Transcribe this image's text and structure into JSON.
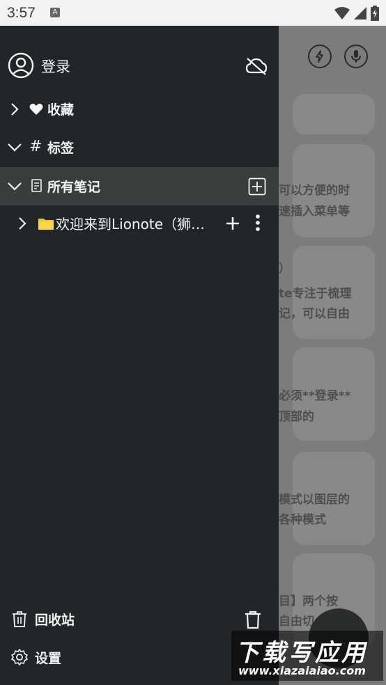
{
  "status_bar": {
    "time": "3:57",
    "sim_label": "A",
    "icons": [
      "wifi-icon",
      "signal-icon",
      "battery-charging-icon"
    ]
  },
  "drawer": {
    "account": {
      "label": "登录",
      "icon": "account-circle-icon",
      "sync_icon": "cloud-off-icon"
    },
    "favorites": {
      "label": "收藏",
      "icon": "heart-icon"
    },
    "tags": {
      "label": "标签",
      "icon": "hash-icon"
    },
    "all_notes": {
      "label": "所有笔记",
      "icon": "note-icon",
      "add_icon": "add-box-icon"
    },
    "notebooks": [
      {
        "label": "欢迎来到Lionote（狮…",
        "icon": "folder-icon"
      }
    ],
    "trash": {
      "label": "回收站",
      "icon": "trash-icon"
    },
    "settings": {
      "label": "设置",
      "icon": "gear-icon"
    }
  },
  "background_app": {
    "top_icons": [
      "flash-icon",
      "mic-icon"
    ],
    "visible_snippets": [
      "可以方便的时",
      "速插入菜单等",
      "）",
      "te专注于梳理",
      "记，可以自由",
      "必须**登录**",
      "顶部的",
      "模式以图层的",
      "各种模式",
      "目】两个按",
      "自由切"
    ]
  },
  "watermark": {
    "title": "下载写应用",
    "url": "www.xiazaiaiao.com"
  }
}
